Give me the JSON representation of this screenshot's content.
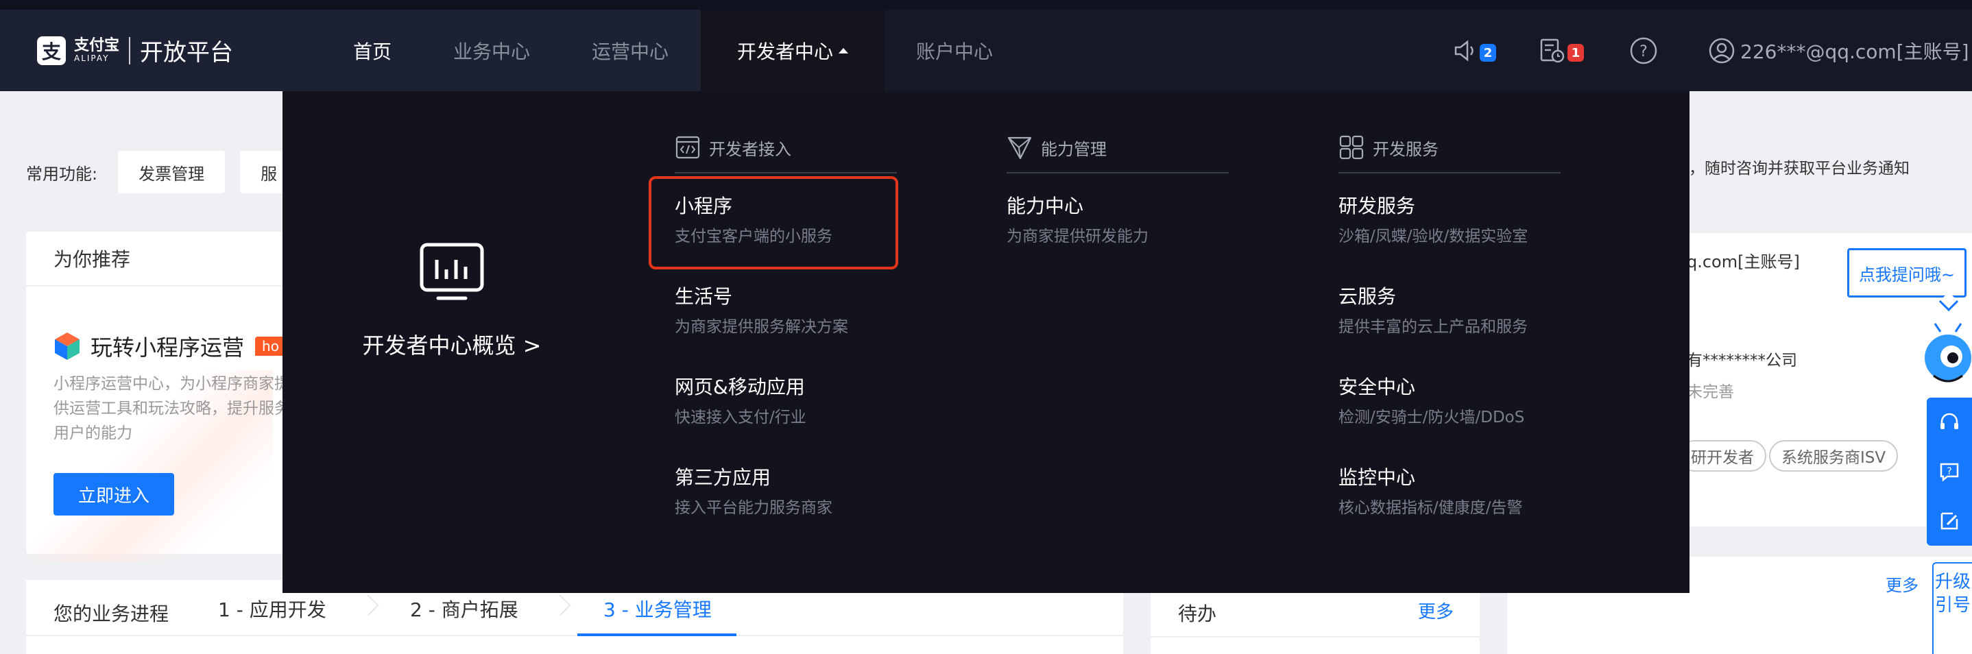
{
  "topbar": {
    "logo_cn": "支付宝",
    "logo_en": "ALIPAY",
    "logo_title": "开放平台",
    "nav": [
      "首页",
      "业务中心",
      "运营中心",
      "开发者中心",
      "账户中心"
    ],
    "notify_count": "2",
    "message_count": "1",
    "user": "226***@qq.com[主账号]",
    "colors": {
      "topbar_bg": "#161925",
      "accent": "#1677ff",
      "alert": "#e53935"
    }
  },
  "quick": {
    "label": "常用功能:",
    "chips": [
      "发票管理",
      "服"
    ]
  },
  "notice": "群，随时咨询并获取平台业务通知",
  "recommend": {
    "head": "为你推荐",
    "title": "玩转小程序运营",
    "badge": "ho",
    "desc": "小程序运营中心，为小程序商家提供运营工具和玩法攻略，提升服务用户的能力",
    "button": "立即进入"
  },
  "progress": {
    "title": "您的业务进程",
    "steps": [
      "1 - 应用开发",
      "2 - 商户拓展",
      "3 - 业务管理"
    ]
  },
  "todo": {
    "title": "待办",
    "more": "更多"
  },
  "account_card": {
    "account": "q.com[主账号]",
    "company": "有********公司",
    "status": "未完善",
    "tags": [
      "研开发者",
      "系统服务商ISV"
    ],
    "more": "更多"
  },
  "assistant": {
    "ask": "点我提问哦~",
    "upgrade": "升级引号"
  },
  "dropdown": {
    "overview": "开发者中心概览 >",
    "columns": [
      {
        "head": "开发者接入",
        "items": [
          {
            "title": "小程序",
            "desc": "支付宝客户端的小服务"
          },
          {
            "title": "生活号",
            "desc": "为商家提供服务解决方案"
          },
          {
            "title": "网页&移动应用",
            "desc": "快速接入支付/行业"
          },
          {
            "title": "第三方应用",
            "desc": "接入平台能力服务商家"
          }
        ]
      },
      {
        "head": "能力管理",
        "items": [
          {
            "title": "能力中心",
            "desc": "为商家提供研发能力"
          }
        ]
      },
      {
        "head": "开发服务",
        "items": [
          {
            "title": "研发服务",
            "desc": "沙箱/凤蝶/验收/数据实验室"
          },
          {
            "title": "云服务",
            "desc": "提供丰富的云上产品和服务"
          },
          {
            "title": "安全中心",
            "desc": "检测/安骑士/防火墙/DDoS"
          },
          {
            "title": "监控中心",
            "desc": "核心数据指标/健康度/告警"
          }
        ]
      }
    ]
  },
  "icons": [
    "alipay-logo-icon",
    "speaker-icon",
    "message-list-icon",
    "help-icon",
    "user-icon",
    "monitor-chart-icon",
    "code-window-icon",
    "paper-plane-icon",
    "grid-apps-icon",
    "headset-icon",
    "question-bubble-icon",
    "edit-icon"
  ]
}
